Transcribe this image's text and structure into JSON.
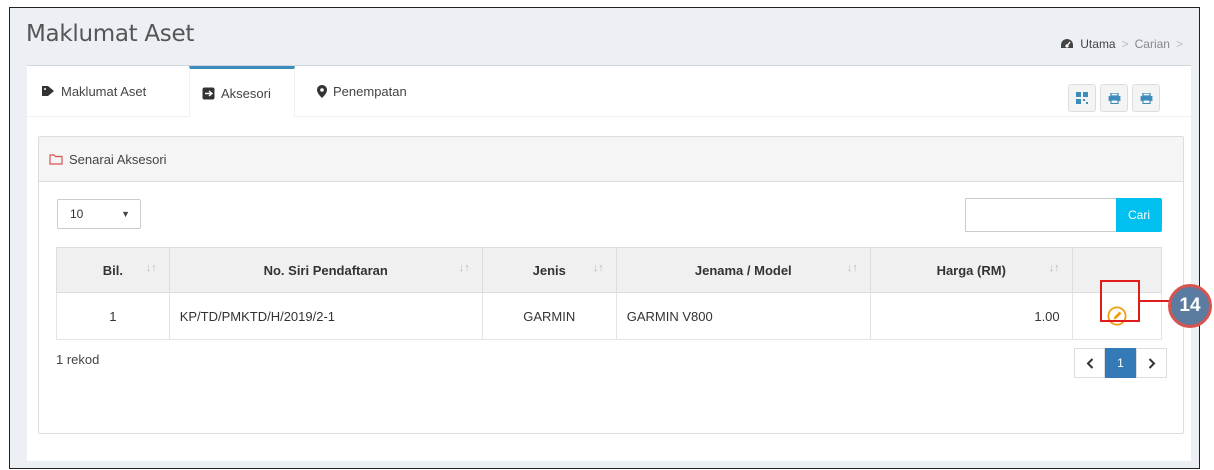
{
  "header": {
    "title": "Maklumat Aset",
    "breadcrumb": [
      "Utama",
      "Carian"
    ]
  },
  "tabs": [
    {
      "label": "Maklumat Aset",
      "icon": "tag-icon"
    },
    {
      "label": "Aksesori",
      "icon": "square-arrow-icon",
      "active": true
    },
    {
      "label": "Penempatan",
      "icon": "map-marker-icon"
    }
  ],
  "toolbar": {
    "buttons": [
      "qrcode-icon",
      "print-icon",
      "print-icon"
    ]
  },
  "panel": {
    "title": "Senarai Aksesori",
    "page_size": "10",
    "search_button": "Cari",
    "search_value": ""
  },
  "table": {
    "headers": [
      "Bil.",
      "No. Siri Pendaftaran",
      "Jenis",
      "Jenama / Model",
      "Harga (RM)",
      ""
    ],
    "rows": [
      {
        "bil": "1",
        "no_siri": "KP/TD/PMKTD/H/2019/2-1",
        "jenis": "GARMIN",
        "jenama_model": "GARMIN V800",
        "harga": "1.00"
      }
    ]
  },
  "footer": {
    "record_count": "1 rekod",
    "pages": [
      "1"
    ]
  },
  "annotation": {
    "number": "14"
  },
  "colors": {
    "accent": "#3c8dbc",
    "search": "#00c0ef",
    "edit": "#f39c12",
    "callout_red": "#e01b1b",
    "badge": "#5b7ba1"
  }
}
